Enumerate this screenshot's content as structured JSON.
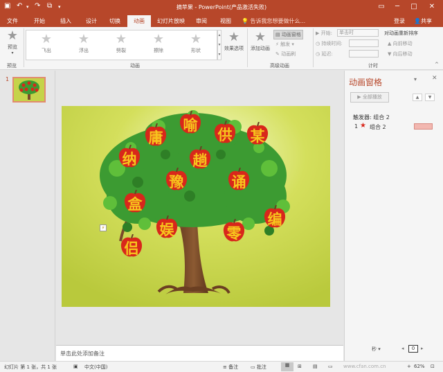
{
  "titlebar": {
    "title": "摘苹果 - PowerPoint(产品激活失败)",
    "qa_save_icon": "save-icon",
    "qa_undo_icon": "undo-icon",
    "qa_redo_icon": "redo-icon",
    "qa_start_icon": "start-from-beginning-icon",
    "qa_more_icon": "customize-toolbar-icon"
  },
  "tabs": [
    "文件",
    "开始",
    "插入",
    "设计",
    "切换",
    "动画",
    "幻灯片放映",
    "审阅",
    "视图"
  ],
  "active_tab": "动画",
  "tellme": "告诉我您想要做什么...",
  "login": "登录",
  "share": "共享",
  "ribbon": {
    "preview_label": "预览",
    "preview_group": "预览",
    "gallery": [
      "飞出",
      "浮出",
      "劈裂",
      "擦除",
      "形状"
    ],
    "effect_options": "效果选项",
    "animation_group": "动画",
    "add_animation": "添加动画",
    "anim_pane_btn": "动画窗格",
    "trigger": "触发",
    "anim_painter": "动画刷",
    "advanced_group": "高级动画",
    "start_label": "开始:",
    "start_value": "单击时",
    "duration_label": "持续时间:",
    "delay_label": "延迟:",
    "timing_group": "计时",
    "reorder_title": "对动画重新排序",
    "move_earlier": "向前移动",
    "move_later": "向后移动"
  },
  "tooltip": "擦除",
  "thumbnail": {
    "number": "1"
  },
  "slide": {
    "apples": [
      "喻",
      "庸",
      "供",
      "某",
      "纳",
      "趟",
      "豫",
      "诵",
      "盒",
      "编",
      "娱",
      "零",
      "侣"
    ],
    "cursor_badge": "⚡"
  },
  "notes_placeholder": "单击此处添加备注",
  "animpane": {
    "title": "动画窗格",
    "play_all": "全部播放",
    "trigger": "触发器: 组合 2",
    "item_number": "1",
    "item_label": "组合 2",
    "seconds_label": "秒",
    "zoom_value": "0"
  },
  "status": {
    "slide_info": "幻灯片 第 1 张，共 1 张",
    "language": "中文(中国)",
    "notes": "备注",
    "comments": "批注",
    "zoom": "62%",
    "watermark": "www.cfan.com.cn"
  },
  "colors": {
    "accent": "#b7472a",
    "apple": "#d8271b",
    "apple_text": "#f7c51d",
    "slide_bg": "#c5d34a",
    "leaf": "#3c9b32",
    "trunk": "#7a4a2a"
  }
}
